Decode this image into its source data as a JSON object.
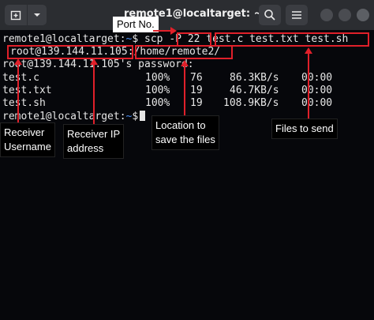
{
  "window": {
    "title": "remote1@localtarget: ~",
    "icons": {
      "new_tab": "new-tab-icon",
      "tab_menu": "chevron-down-icon",
      "search": "search-icon",
      "menu": "hamburger-menu-icon"
    }
  },
  "terminal": {
    "prompt_user": "remote1@localtarget",
    "prompt_sep": ":",
    "prompt_path": "~",
    "prompt_symbol": "$",
    "command_prefix": "scp ",
    "command_port": "-P 22",
    "command_files": "test.c test.txt test.sh",
    "destination_login": "root@139.144.11.105",
    "destination_sep": ":",
    "destination_path": "/home/remote2/",
    "password_line": "root@139.144.11.105's password:",
    "transfers": [
      {
        "name": "test.c",
        "percent": "100%",
        "size": "76",
        "rate": "86.3KB/s",
        "time": "00:00"
      },
      {
        "name": "test.txt",
        "percent": "100%",
        "size": "19",
        "rate": "46.7KB/s",
        "time": "00:00"
      },
      {
        "name": "test.sh",
        "percent": "100%",
        "size": "19",
        "rate": "108.9KB/s",
        "time": "00:00"
      }
    ]
  },
  "annotations": {
    "port_no": "Port No.",
    "receiver_username": "Receiver\nUsername",
    "receiver_ip": "Receiver IP\naddress",
    "location": "Location to\nsave the files",
    "files_to_send": "Files to send",
    "accent_color": "#e0202a"
  }
}
